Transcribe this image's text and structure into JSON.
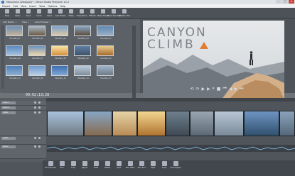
{
  "window": {
    "title": "Mountains (Dialogue)* - Movie Studio Platinum 13.0",
    "controls": [
      "–",
      "□",
      "×"
    ]
  },
  "menu": [
    "Project",
    "Edit",
    "View",
    "Insert",
    "Tools",
    "Options",
    "Help"
  ],
  "toolbar": [
    "New",
    "Open",
    "Save",
    "Undo",
    "Redo",
    "Add Media",
    "Titles",
    "Transitions",
    "Effects",
    "Make Movie",
    "Show Me How",
    "What's This"
  ],
  "left_pane": {
    "toolbar": [
      "Add Media",
      "View",
      "Auto Preview"
    ],
    "tabs": [
      "Project Media",
      "Transitions",
      "Effects"
    ],
    "active_tab": "Project Media",
    "thumbnails": [
      "Mountain_01",
      "Mountain_02",
      "Mountain_03",
      "Mountain_04",
      "Mountain_05",
      "Mountain_06",
      "Mountain_07",
      "Mountain_08",
      "Mountain_09",
      "Mountain_10",
      "Mountain_11",
      "Mountain_12",
      "Mountain_13",
      "Mountain_14",
      "Mountain_15"
    ]
  },
  "preview": {
    "title_line1": "CANYON",
    "title_line2": "CLIMB",
    "accent_color": "#e07d33"
  },
  "transport": {
    "buttons": [
      "⟲",
      "⟳",
      "▶",
      "▶",
      "⏸",
      "■",
      "⏮",
      "◀",
      "▶",
      "⏭"
    ],
    "timecode": "00:02:13;28"
  },
  "timeline": {
    "tracks": [
      {
        "name": "Track 1"
      },
      {
        "name": "Track 2"
      },
      {
        "name": "Video"
      },
      {
        "name": "Audio"
      },
      {
        "name": "Music"
      }
    ]
  },
  "bottom_toolbar": [
    "Normal Edit",
    "Trim",
    "Crop",
    "Ripple",
    "Mute",
    "Delete",
    "Split",
    "Trim Start",
    "Trim End",
    "Split",
    "Snap",
    "Auto Ripple"
  ]
}
